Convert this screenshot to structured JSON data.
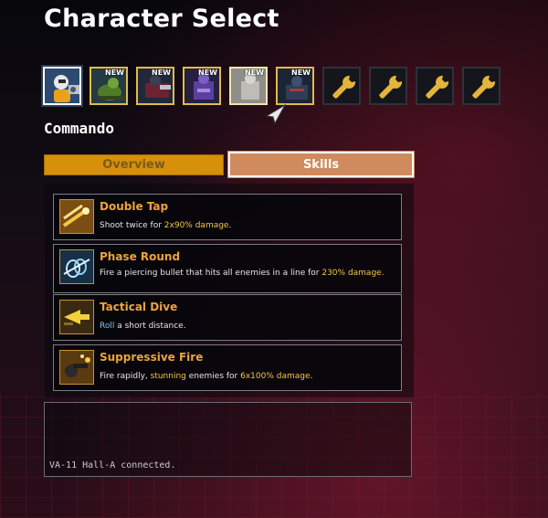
{
  "screen_title": "Character Select",
  "portraits": [
    {
      "character": "Commando",
      "new_badge": "",
      "state": "selected"
    },
    {
      "character": "portrait-2",
      "new_badge": "NEW",
      "state": "unlocked"
    },
    {
      "character": "portrait-3",
      "new_badge": "NEW",
      "state": "unlocked"
    },
    {
      "character": "portrait-4",
      "new_badge": "NEW",
      "state": "unlocked"
    },
    {
      "character": "portrait-5",
      "new_badge": "NEW",
      "state": "unlocked"
    },
    {
      "character": "portrait-6",
      "new_badge": "NEW",
      "state": "unlocked"
    },
    {
      "character": "locked",
      "new_badge": "",
      "state": "locked",
      "icon": "wrench-icon"
    },
    {
      "character": "locked",
      "new_badge": "",
      "state": "locked",
      "icon": "wrench-icon"
    },
    {
      "character": "locked",
      "new_badge": "",
      "state": "locked",
      "icon": "wrench-icon"
    },
    {
      "character": "locked",
      "new_badge": "",
      "state": "locked",
      "icon": "wrench-icon"
    }
  ],
  "selected_character": "Commando",
  "tabs": {
    "overview": "Overview",
    "skills": "Skills",
    "active": "skills"
  },
  "skills": [
    {
      "name": "Double Tap",
      "desc_parts": [
        "Shoot twice for ",
        "2x90% damage",
        "."
      ],
      "icon": "double-tap-icon"
    },
    {
      "name": "Phase Round",
      "desc_parts": [
        "Fire a piercing bullet that hits all enemies in a line for ",
        "230%",
        " damage."
      ],
      "icon": "phase-round-icon"
    },
    {
      "name": "Tactical Dive",
      "desc_parts": [
        "Roll",
        " a short distance.",
        ""
      ],
      "icon": "tactical-dive-icon"
    },
    {
      "name": "Suppressive Fire",
      "desc_parts": [
        "Fire rapidly, ",
        "stunning",
        " enemies for ",
        "6x100% damage",
        "."
      ],
      "icon": "suppressive-fire-icon"
    }
  ],
  "chat": {
    "message": "VA-11 Hall-A connected."
  },
  "colors": {
    "accent_orange": "#f0a23a",
    "highlight_yellow": "#f3c547",
    "highlight_blue": "#77c8ea",
    "tab_skills": "#cf8a5e",
    "tab_overview": "#d6900a"
  }
}
